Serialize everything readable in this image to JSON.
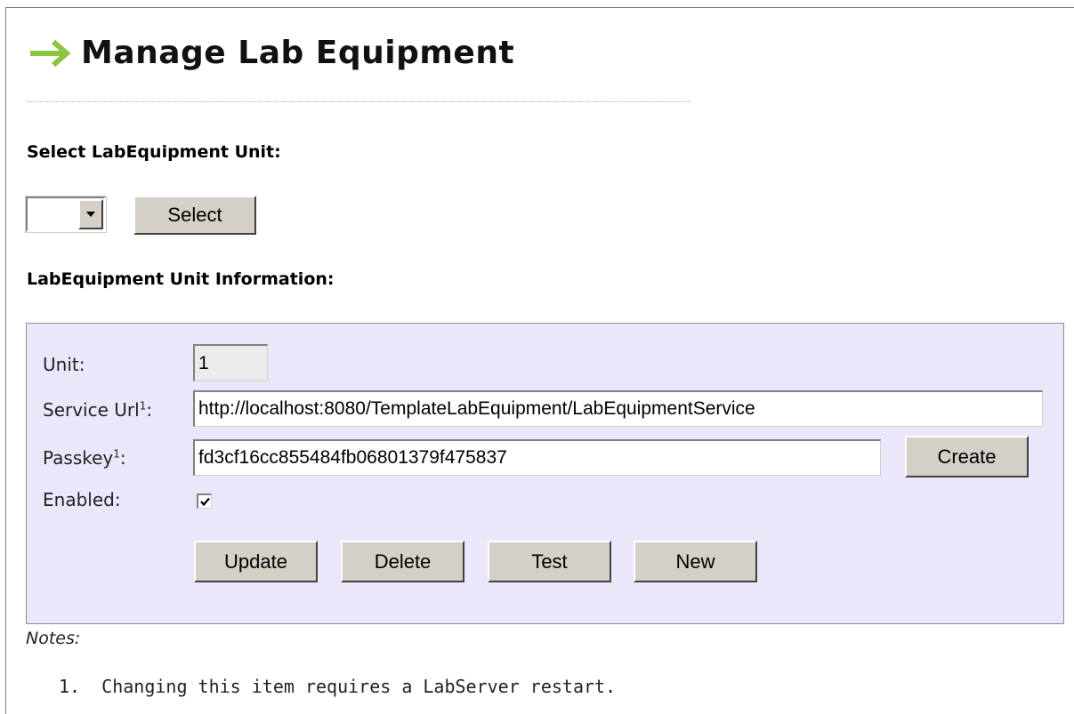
{
  "page": {
    "title": "Manage Lab Equipment"
  },
  "select_section": {
    "label": "Select LabEquipment Unit:",
    "dropdown_value": "",
    "select_button": "Select"
  },
  "info_section": {
    "label": "LabEquipment Unit Information:",
    "fields": {
      "unit_label": "Unit:",
      "unit_value": "1",
      "service_url_label": "Service Url",
      "service_url_note_ref": "1",
      "service_url_value": "http://localhost:8080/TemplateLabEquipment/LabEquipmentService",
      "passkey_label": "Passkey",
      "passkey_note_ref": "1",
      "passkey_value": "fd3cf16cc855484fb06801379f475837",
      "create_button": "Create",
      "enabled_label": "Enabled:",
      "enabled_checked": true
    },
    "buttons": {
      "update": "Update",
      "delete": "Delete",
      "test": "Test",
      "new": "New"
    }
  },
  "notes": {
    "label": "Notes:",
    "items": [
      "1.  Changing this item requires a LabServer restart."
    ]
  },
  "colors": {
    "accent_arrow": "#8cc63f",
    "panel_background": "#ece6fa",
    "button_face": "#d4d0c8"
  },
  "icons": {
    "title_icon": "right-arrow-icon",
    "dropdown_icon": "chevron-down-icon",
    "checkbox_icon": "checkmark-icon"
  }
}
